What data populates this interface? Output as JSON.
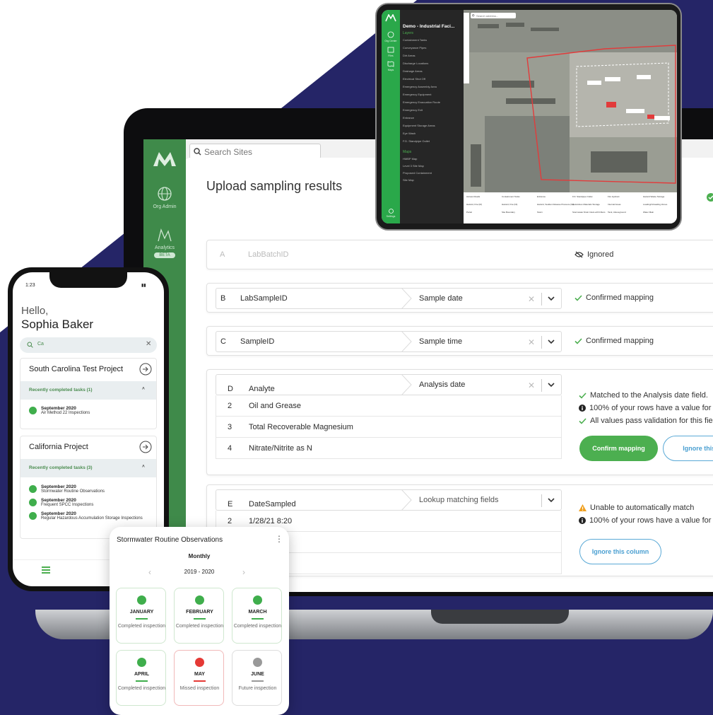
{
  "colors": {
    "navy": "#252567",
    "brand_green": "#3f8a4a",
    "success": "#4caf50",
    "error": "#e53935",
    "link_blue": "#4a9fd1"
  },
  "laptop": {
    "search_placeholder": "Search Sites",
    "nav": [
      {
        "label": "Org Admin",
        "icon": "globe-icon"
      },
      {
        "label": "Analytics",
        "badge": "BETA",
        "icon": "analytics-icon"
      }
    ],
    "modal_title": "Upload sampling results",
    "rows": [
      {
        "letter": "A",
        "source": "LabBatchID",
        "target": "",
        "status": "Ignored",
        "status_icon": "eye-off-icon"
      },
      {
        "letter": "B",
        "source": "LabSampleID",
        "target": "Sample date",
        "status": "Confirmed mapping",
        "status_icon": "check-icon"
      },
      {
        "letter": "C",
        "source": "SampleID",
        "target": "Sample time",
        "status": "Confirmed mapping",
        "status_icon": "check-icon"
      },
      {
        "letter": "D",
        "source": "Analyte",
        "target": "Analysis date",
        "values": [
          {
            "n": "2",
            "v": "Oil and Grease"
          },
          {
            "n": "3",
            "v": "Total Recoverable Magnesium"
          },
          {
            "n": "4",
            "v": "Nitrate/Nitrite as N"
          }
        ],
        "messages": [
          "Matched to the  Analysis date  field.",
          "100% of your rows have a value for th",
          "All values pass validation for this field"
        ],
        "confirm_label": "Confirm mapping",
        "ignore_label": "Ignore this c"
      },
      {
        "letter": "E",
        "source": "DateSampled",
        "target": "Lookup matching fields",
        "values": [
          {
            "n": "2",
            "v": "1/28/21 8:20"
          }
        ],
        "messages": [
          "Unable to automatically match",
          "100% of your rows have a value for th"
        ],
        "ignore_label": "Ignore this column"
      }
    ]
  },
  "tablet": {
    "title": "Demo - Industrial Faci...",
    "layers_label": "Layers",
    "maps_label": "Maps",
    "search_placeholder": "Search address...",
    "rail": [
      "Org Center",
      "Files",
      "Maps",
      "Settings"
    ],
    "layers": [
      "Containment Tanks",
      "Conveyance Pipes",
      "Dirt Areas",
      "Discharge Locations",
      "Drainage Areas",
      "Electrical Shut Off",
      "Emergency Assembly Area",
      "Emergency Equipment",
      "Emergency Evacuation Route",
      "Emergency Exit",
      "Entrance",
      "Equipment Storage Areas",
      "Eye Wash",
      "F.D. Standpipe Outlet"
    ],
    "maps": [
      "HMBP Map",
      "Level 3 Site Map",
      "Proposed Containment",
      "Site Map"
    ],
    "legend": [
      "Access Roads",
      "Containment Tanks",
      "Entrance",
      "F.D. Standpipe Outlet",
      "Fire Hydrant",
      "Hazard Waste Storage",
      "Hazard, Fire (M)",
      "Hazard, Fire (NI)",
      "Hazard, Sudden Release Pressure (M)",
      "Hazardous Materials Storage",
      "Internal Areas",
      "Loading/Unloading Zones",
      "Portal",
      "Site Boundary",
      "Storm",
      "Stormwater Drain Inlets with Filters",
      "Tank, Aboveground",
      "Water Main"
    ]
  },
  "phone": {
    "time": "1:23",
    "greeting": "Hello,",
    "name": "Sophia Baker",
    "search_value": "Ca",
    "projects": [
      {
        "name": "South Carolina Test Project",
        "subheader": "Recently completed tasks (1)",
        "tasks": [
          {
            "date": "September 2020",
            "title": "Air Method 22 Inspections"
          }
        ]
      },
      {
        "name": "California Project",
        "subheader": "Recently completed tasks (3)",
        "tasks": [
          {
            "date": "September 2020",
            "title": "Stormwater Routine Observations"
          },
          {
            "date": "September 2020",
            "title": "Frequent SPCC Inspections"
          },
          {
            "date": "September 2020",
            "title": "Regular Hazardous Accumulation Storage Inspections"
          }
        ]
      }
    ]
  },
  "card": {
    "title": "Stormwater Routine Observations",
    "frequency": "Monthly",
    "range": "2019 - 2020",
    "months": [
      {
        "name": "JANUARY",
        "status": "Completed inspection",
        "state": "ok"
      },
      {
        "name": "FEBRUARY",
        "status": "Completed inspection",
        "state": "ok"
      },
      {
        "name": "MARCH",
        "status": "Completed inspection",
        "state": "ok"
      },
      {
        "name": "APRIL",
        "status": "Completed inspection",
        "state": "ok"
      },
      {
        "name": "MAY",
        "status": "Missed inspection",
        "state": "bad"
      },
      {
        "name": "JUNE",
        "status": "Future inspection",
        "state": "fut"
      }
    ]
  }
}
